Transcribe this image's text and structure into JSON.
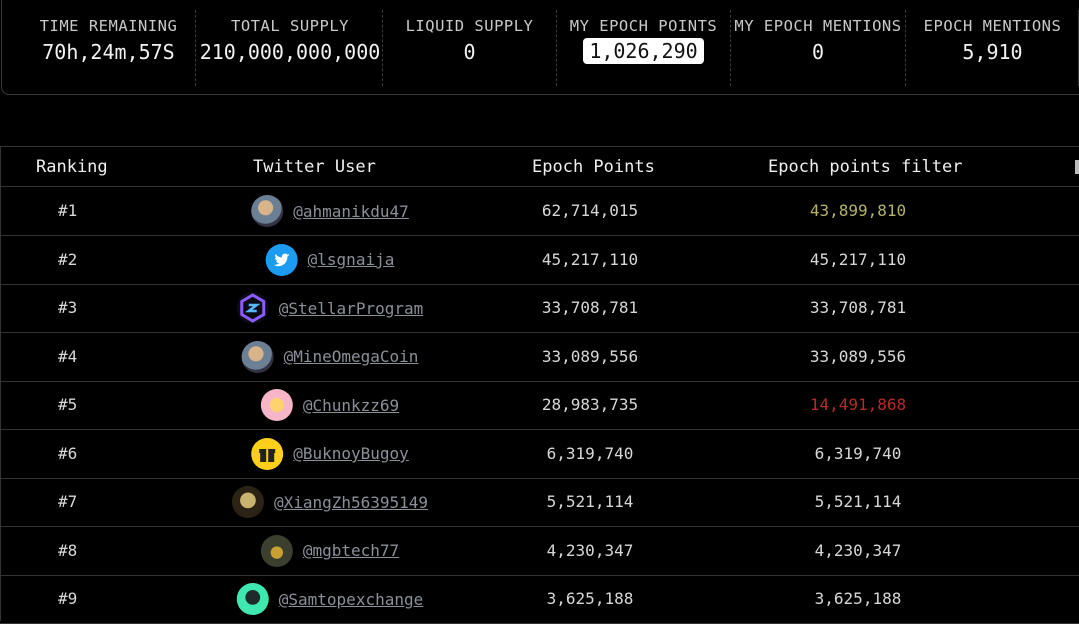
{
  "stats": [
    {
      "label": "TIME REMAINING",
      "value": "70h,24m,57S"
    },
    {
      "label": "TOTAL SUPPLY",
      "value": "210,000,000,000"
    },
    {
      "label": "LIQUID SUPPLY",
      "value": "0"
    },
    {
      "label": "MY EPOCH POINTS",
      "value": "1,026,290",
      "highlight": true
    },
    {
      "label": "MY EPOCH MENTIONS",
      "value": "0"
    },
    {
      "label": "EPOCH MENTIONS",
      "value": "5,910"
    }
  ],
  "table": {
    "headers": [
      "Ranking",
      "Twitter User",
      "Epoch Points",
      "Epoch points filter"
    ],
    "rows": [
      {
        "rank": "#1",
        "handle": "@ahmanikdu47",
        "avatar": "photo-avatar",
        "points": "62,714,015",
        "filter": "43,899,810",
        "filter_status": "reduced-olive"
      },
      {
        "rank": "#2",
        "handle": "@lsgnaija",
        "avatar": "twitter-bird-avatar",
        "points": "45,217,110",
        "filter": "45,217,110",
        "filter_status": "normal"
      },
      {
        "rank": "#3",
        "handle": "@StellarProgram",
        "avatar": "hexagon-logo-avatar",
        "points": "33,708,781",
        "filter": "33,708,781",
        "filter_status": "normal"
      },
      {
        "rank": "#4",
        "handle": "@MineOmegaCoin",
        "avatar": "photo-avatar",
        "points": "33,089,556",
        "filter": "33,089,556",
        "filter_status": "normal"
      },
      {
        "rank": "#5",
        "handle": "@Chunkzz69",
        "avatar": "pink-hands-avatar",
        "points": "28,983,735",
        "filter": "14,491,868",
        "filter_status": "reduced-red"
      },
      {
        "rank": "#6",
        "handle": "@BuknoyBugoy",
        "avatar": "gift-box-avatar",
        "points": "6,319,740",
        "filter": "6,319,740",
        "filter_status": "normal"
      },
      {
        "rank": "#7",
        "handle": "@XiangZh56395149",
        "avatar": "cat-avatar",
        "points": "5,521,114",
        "filter": "5,521,114",
        "filter_status": "normal"
      },
      {
        "rank": "#8",
        "handle": "@mgbtech77",
        "avatar": "logo-avatar",
        "points": "4,230,347",
        "filter": "4,230,347",
        "filter_status": "normal"
      },
      {
        "rank": "#9",
        "handle": "@Samtopexchange",
        "avatar": "green-silhouette-avatar",
        "points": "3,625,188",
        "filter": "3,625,188",
        "filter_status": "normal"
      }
    ]
  },
  "colors": {
    "background": "#000000",
    "border": "#333333",
    "link": "#8a8f99",
    "filter_reduced_olive": "#b5b26a",
    "filter_reduced_red": "#b42b2b"
  }
}
